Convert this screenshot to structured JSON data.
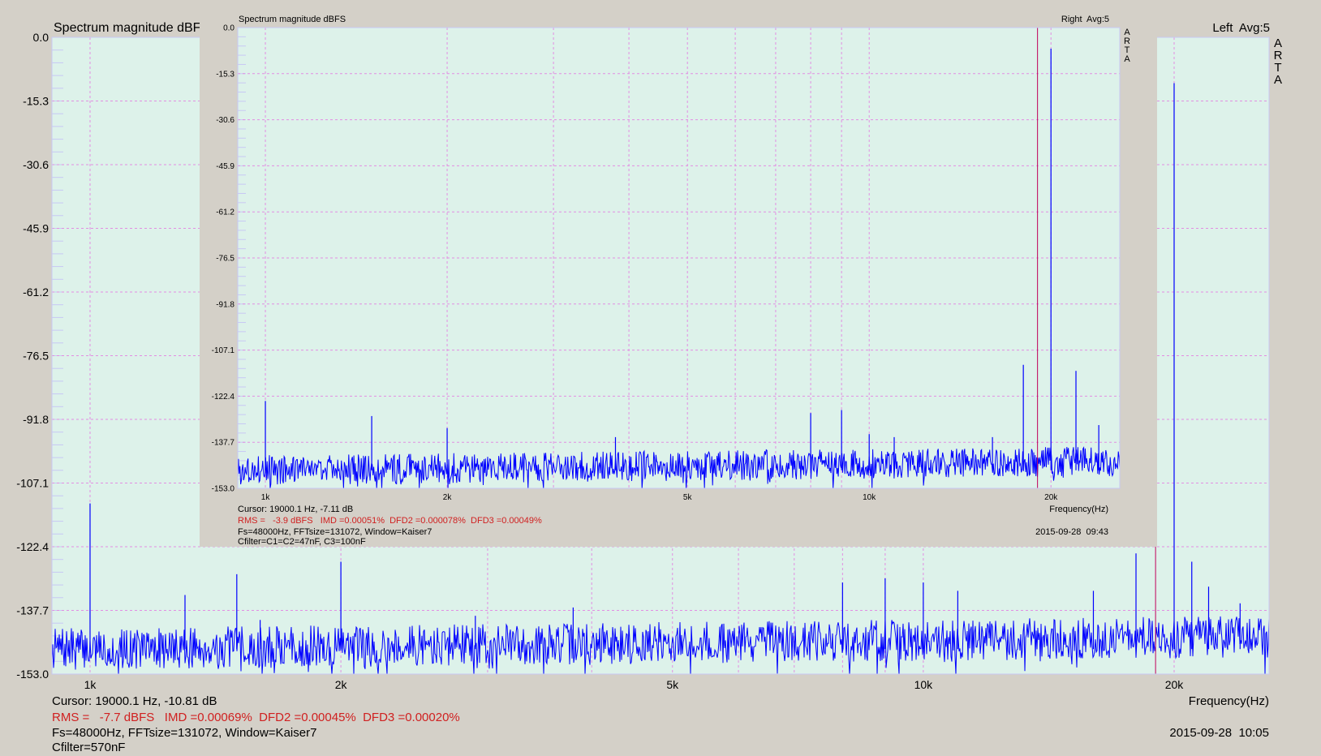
{
  "colors": {
    "plot_bg": "#ddf2ea",
    "frame": "#c8c8f4",
    "grid": "#e28ee2",
    "trace": "#0000ff",
    "cursor": "#c0005a",
    "stats": "#d02020",
    "window_bg": "#d4d0c8"
  },
  "chart_data": [
    {
      "id": "main",
      "type": "line",
      "title": "Spectrum magnitude dBF:",
      "channel": "Left  Avg:5",
      "brand": "ARTA",
      "xlabel": "Frequency(Hz)",
      "x_scale": "log",
      "xlim": [
        900,
        26000
      ],
      "ylim": [
        -153.0,
        0.0
      ],
      "y_ticks": [
        "0.0",
        "-15.3",
        "-30.6",
        "-45.9",
        "-61.2",
        "-76.5",
        "-91.8",
        "-107.1",
        "-122.4",
        "-137.7",
        "-153.0"
      ],
      "x_ticks": [
        {
          "value": 1000,
          "label": "1k"
        },
        {
          "value": 2000,
          "label": "2k"
        },
        {
          "value": 5000,
          "label": "5k"
        },
        {
          "value": 10000,
          "label": "10k"
        },
        {
          "value": 20000,
          "label": "20k"
        }
      ],
      "x_grid": [
        1000,
        2000,
        3000,
        4000,
        5000,
        6000,
        7000,
        8000,
        9000,
        10000,
        20000
      ],
      "noise_floor_db": [
        -150,
        -144
      ],
      "cursor_hz": 19000.1,
      "series": [
        {
          "peaks": [
            {
              "f": 1000,
              "db": -112
            },
            {
              "f": 1300,
              "db": -134
            },
            {
              "f": 1500,
              "db": -129
            },
            {
              "f": 1600,
              "db": -140
            },
            {
              "f": 2000,
              "db": -126
            },
            {
              "f": 2900,
              "db": -139
            },
            {
              "f": 3800,
              "db": -137
            },
            {
              "f": 8000,
              "db": -131
            },
            {
              "f": 9000,
              "db": -130
            },
            {
              "f": 10000,
              "db": -131
            },
            {
              "f": 11000,
              "db": -133
            },
            {
              "f": 16000,
              "db": -133
            },
            {
              "f": 18000,
              "db": -124
            },
            {
              "f": 20000,
              "db": -11
            },
            {
              "f": 21000,
              "db": -126
            },
            {
              "f": 22000,
              "db": -132
            },
            {
              "f": 24000,
              "db": -136
            }
          ]
        }
      ],
      "readouts": {
        "cursor": "Cursor: 19000.1 Hz, -10.81 dB",
        "stats": "RMS =   -7.7 dBFS   IMD =0.00069%  DFD2 =0.00045%  DFD3 =0.00020%",
        "fs": "Fs=48000Hz, FFTsize=131072, Window=Kaiser7",
        "filter": "Cfilter=570nF",
        "date": "2015-09-28  10:05"
      }
    },
    {
      "id": "inset",
      "type": "line",
      "title": "Spectrum magnitude dBFS",
      "channel": "Right  Avg:5",
      "brand": "ARTA",
      "xlabel": "Frequency(Hz)",
      "x_scale": "log",
      "xlim": [
        900,
        26000
      ],
      "ylim": [
        -153.0,
        0.0
      ],
      "y_ticks": [
        "0.0",
        "-15.3",
        "-30.6",
        "-45.9",
        "-61.2",
        "-76.5",
        "-91.8",
        "-107.1",
        "-122.4",
        "-137.7",
        "-153.0"
      ],
      "x_ticks": [
        {
          "value": 1000,
          "label": "1k"
        },
        {
          "value": 2000,
          "label": "2k"
        },
        {
          "value": 5000,
          "label": "5k"
        },
        {
          "value": 10000,
          "label": "10k"
        },
        {
          "value": 20000,
          "label": "20k"
        }
      ],
      "x_grid": [
        1000,
        2000,
        3000,
        4000,
        5000,
        6000,
        7000,
        8000,
        9000,
        10000,
        20000
      ],
      "noise_floor_db": [
        -150,
        -144
      ],
      "cursor_hz": 19000.1,
      "series": [
        {
          "peaks": [
            {
              "f": 1000,
              "db": -124
            },
            {
              "f": 1500,
              "db": -129
            },
            {
              "f": 2000,
              "db": -133
            },
            {
              "f": 3800,
              "db": -136
            },
            {
              "f": 8000,
              "db": -128
            },
            {
              "f": 9000,
              "db": -127
            },
            {
              "f": 10000,
              "db": -135
            },
            {
              "f": 11000,
              "db": -136
            },
            {
              "f": 16000,
              "db": -136
            },
            {
              "f": 18000,
              "db": -112
            },
            {
              "f": 20000,
              "db": -7
            },
            {
              "f": 22000,
              "db": -114
            },
            {
              "f": 24000,
              "db": -132
            }
          ]
        }
      ],
      "readouts": {
        "cursor": "Cursor: 19000.1 Hz, -7.11 dB",
        "stats": "RMS =   -3.9 dBFS   IMD =0.00051%  DFD2 =0.000078%  DFD3 =0.00049%",
        "fs": "Fs=48000Hz, FFTsize=131072, Window=Kaiser7",
        "filter": "Cfilter=C1=C2=47nF, C3=100nF",
        "date": "2015-09-28  09:43"
      }
    }
  ]
}
